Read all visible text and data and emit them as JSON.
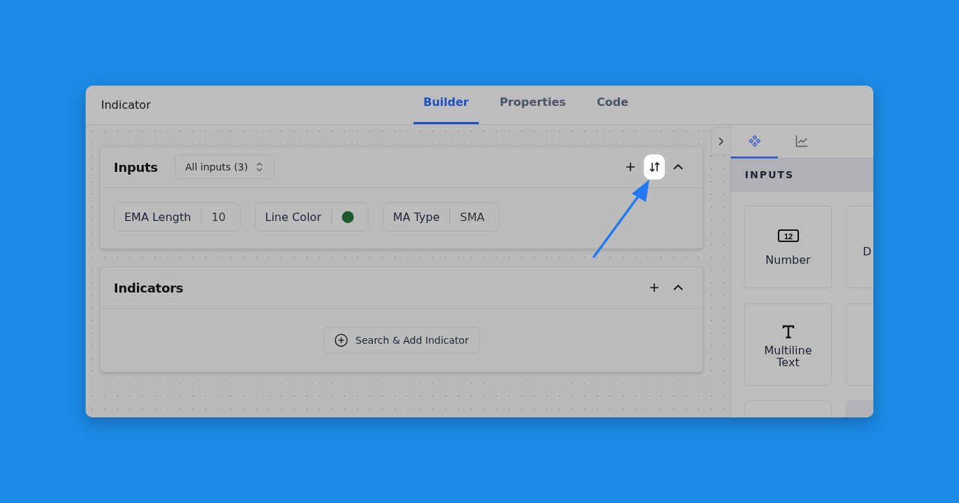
{
  "window": {
    "title": "Indicator"
  },
  "tabs": [
    {
      "label": "Builder",
      "selected": true
    },
    {
      "label": "Properties",
      "selected": false
    },
    {
      "label": "Code",
      "selected": false
    }
  ],
  "sections": [
    {
      "title": "Inputs",
      "filter": "All inputs (3)",
      "actions": [
        {
          "kind": "add",
          "highlighted": false
        },
        {
          "kind": "sort",
          "highlighted": true
        },
        {
          "kind": "collapse",
          "highlighted": false
        }
      ],
      "inputs": [
        {
          "kind": "text",
          "label": "EMA Length",
          "value": "10"
        },
        {
          "kind": "color",
          "label": "Line Color",
          "color": "#1f5a2e"
        },
        {
          "kind": "text",
          "label": "MA Type",
          "value": "SMA"
        }
      ]
    },
    {
      "title": "Indicators",
      "actions": [
        {
          "kind": "add",
          "highlighted": false
        },
        {
          "kind": "collapse",
          "highlighted": false
        }
      ],
      "button": "Search & Add Indicator"
    }
  ],
  "panel": {
    "tabs": [
      {
        "kind": "components",
        "selected": true
      },
      {
        "kind": "chart",
        "selected": false
      }
    ],
    "heading": "INPUTS",
    "cards": [
      {
        "kind": "number",
        "label": "Number",
        "icon_text": "12"
      },
      {
        "kind": "cut",
        "label": "D"
      },
      {
        "kind": "text",
        "label": "Multiline Text"
      },
      {
        "kind": "blank"
      },
      {
        "kind": "blank"
      },
      {
        "kind": "blank"
      }
    ]
  }
}
